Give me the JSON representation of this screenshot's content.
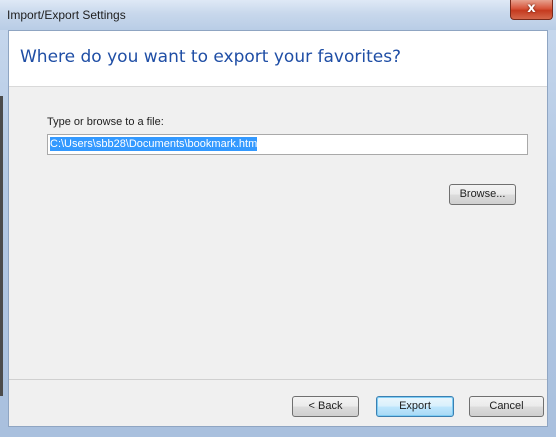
{
  "window": {
    "title": "Import/Export Settings",
    "close_glyph": "x"
  },
  "main": {
    "heading": "Where do you want to export your favorites?",
    "file_label": "Type or browse to a file:",
    "file_path": "C:\\Users\\sbb28\\Documents\\bookmark.htm",
    "browse_label": "Browse..."
  },
  "footer": {
    "back_label": "< Back",
    "export_label": "Export",
    "cancel_label": "Cancel"
  },
  "colors": {
    "heading": "#1f4ea5",
    "selection": "#3399ff",
    "close_button": "#c53a1f"
  }
}
